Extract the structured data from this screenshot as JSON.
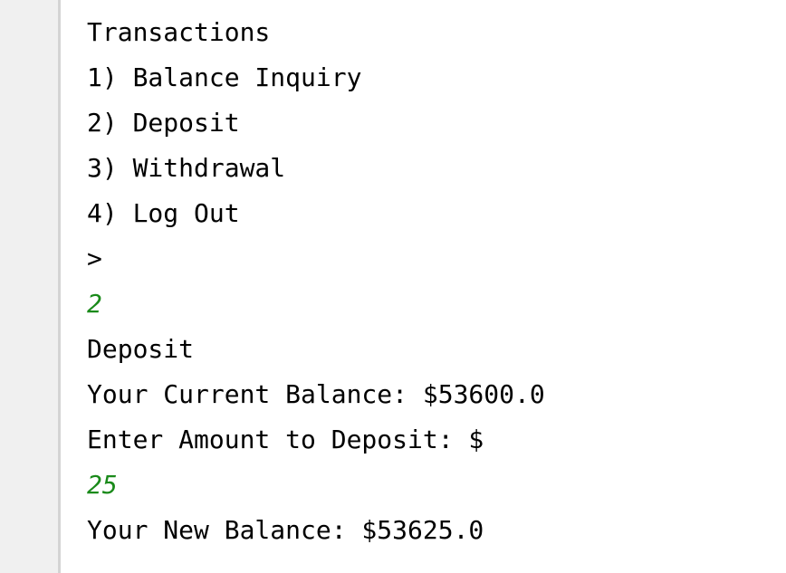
{
  "console": {
    "lines": [
      {
        "text": "Transactions",
        "kind": "output"
      },
      {
        "text": "1) Balance Inquiry",
        "kind": "output"
      },
      {
        "text": "2) Deposit",
        "kind": "output"
      },
      {
        "text": "3) Withdrawal",
        "kind": "output"
      },
      {
        "text": "4) Log Out",
        "kind": "output"
      },
      {
        "text": ">",
        "kind": "output"
      },
      {
        "text": "2",
        "kind": "input"
      },
      {
        "text": "Deposit",
        "kind": "output"
      },
      {
        "text": "Your Current Balance: $53600.0",
        "kind": "output"
      },
      {
        "text": "Enter Amount to Deposit: $",
        "kind": "output"
      },
      {
        "text": "25",
        "kind": "input"
      },
      {
        "text": "Your New Balance: $53625.0",
        "kind": "output"
      }
    ]
  },
  "colors": {
    "output_text": "#000000",
    "user_input_text": "#1a8a1a",
    "gutter_background": "#f0f0f0",
    "gutter_border": "#d4d4d4"
  }
}
